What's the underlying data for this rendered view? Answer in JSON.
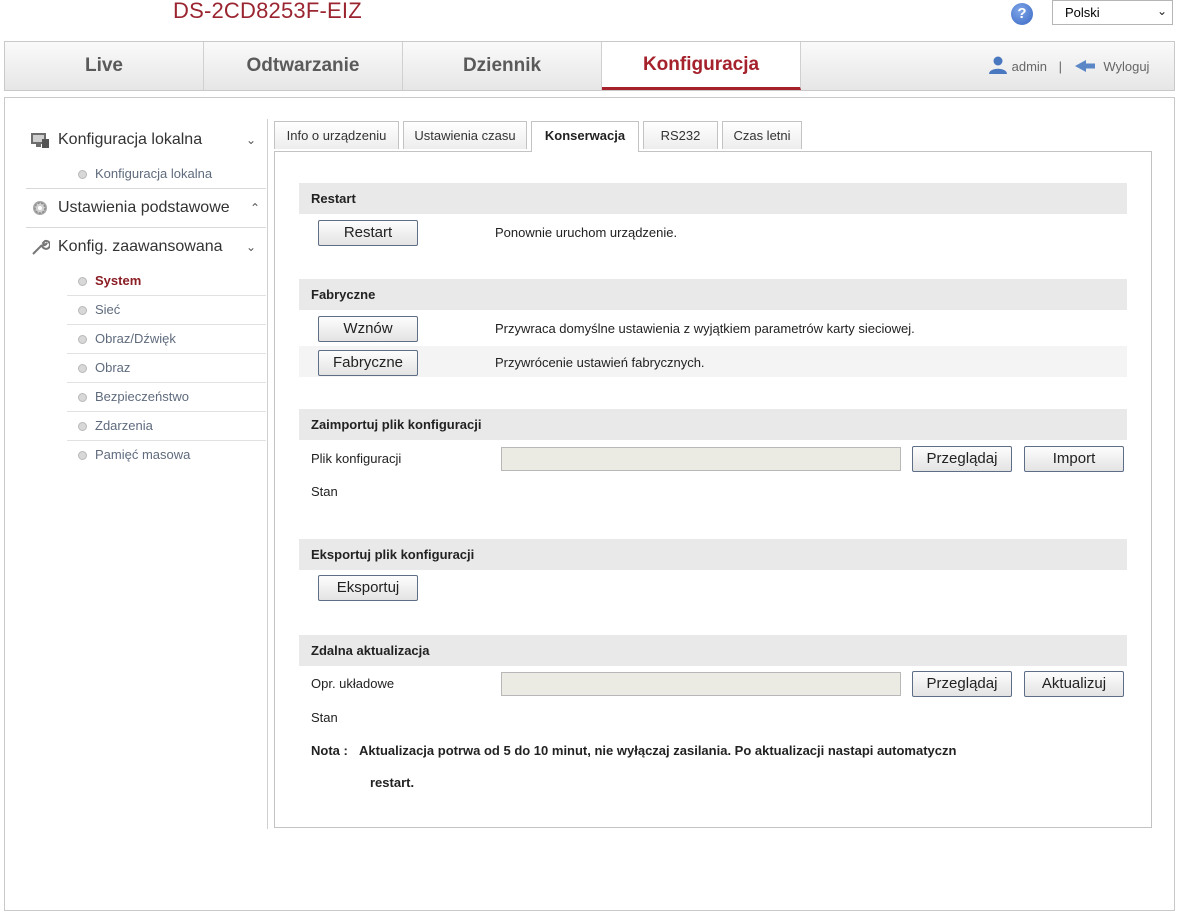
{
  "header": {
    "model": "DS-2CD8253F-EIZ",
    "help_icon": "question-icon",
    "help_glyph": "?",
    "language": "Polski"
  },
  "topnav": {
    "tabs": [
      {
        "label": "Live"
      },
      {
        "label": "Odtwarzanie"
      },
      {
        "label": "Dziennik"
      },
      {
        "label": "Konfiguracja",
        "active": true
      }
    ],
    "user": "admin",
    "separator": "|",
    "logout": "Wyloguj"
  },
  "sidebar": {
    "local_config": {
      "label": "Konfiguracja lokalna",
      "icon": "monitor-icon",
      "items": [
        {
          "label": "Konfiguracja lokalna"
        }
      ]
    },
    "basic_settings": {
      "label": "Ustawienia podstawowe",
      "icon": "gear-icon"
    },
    "advanced": {
      "label": "Konfig. zaawansowana",
      "icon": "wrench-icon",
      "items": [
        {
          "label": "System",
          "active": true
        },
        {
          "label": "Sieć"
        },
        {
          "label": "Obraz/Dźwięk"
        },
        {
          "label": "Obraz"
        },
        {
          "label": "Bezpieczeństwo"
        },
        {
          "label": "Zdarzenia"
        },
        {
          "label": "Pamięć masowa"
        }
      ]
    }
  },
  "subtabs": [
    {
      "label": "Info o urządzeniu"
    },
    {
      "label": "Ustawienia czasu"
    },
    {
      "label": "Konserwacja",
      "active": true
    },
    {
      "label": "RS232"
    },
    {
      "label": "Czas letni"
    }
  ],
  "restart": {
    "title": "Restart",
    "button": "Restart",
    "desc": "Ponownie uruchom urządzenie."
  },
  "factory": {
    "title": "Fabryczne",
    "restore_button": "Wznów",
    "restore_desc": "Przywraca domyślne ustawienia z wyjątkiem parametrów karty sieciowej.",
    "default_button": "Fabryczne",
    "default_desc": "Przywrócenie ustawień fabrycznych."
  },
  "import_config": {
    "title": "Zaimportuj plik konfiguracji",
    "file_label": "Plik konfiguracji",
    "file_value": "",
    "browse_button": "Przeglądaj",
    "import_button": "Import",
    "status_label": "Stan"
  },
  "export_config": {
    "title": "Eksportuj plik konfiguracji",
    "export_button": "Eksportuj"
  },
  "remote_upgrade": {
    "title": "Zdalna aktualizacja",
    "firmware_label": "Opr. układowe",
    "firmware_value": "",
    "browse_button": "Przeglądaj",
    "upgrade_button": "Aktualizuj",
    "status_label": "Stan",
    "note_label": "Nota :",
    "note_line1": "Aktualizacja potrwa od 5 do 10 minut, nie wyłączaj zasilania. Po aktualizacji nastapi automatyczn",
    "note_line2": "restart."
  },
  "colors": {
    "accent": "#a5222d",
    "section_bg": "#e9e9e9",
    "link": "#5f6b7d"
  }
}
